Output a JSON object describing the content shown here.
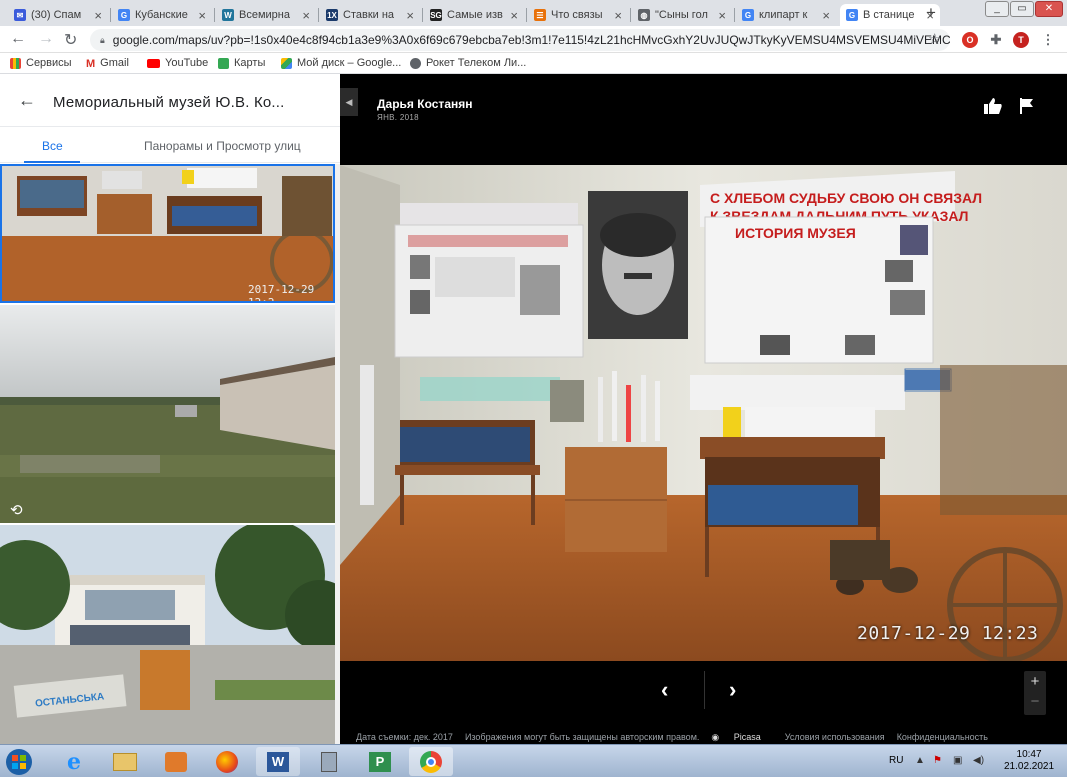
{
  "browser": {
    "tabs": [
      {
        "title": "(30) Спам",
        "icon": "mail-icon",
        "color": "#3b5bdb",
        "glyph": "✉"
      },
      {
        "title": "Кубанские",
        "icon": "google-icon",
        "color": "#4285f4",
        "glyph": "G"
      },
      {
        "title": "Всемирна",
        "icon": "wordpress-icon",
        "color": "#21759b",
        "glyph": "W"
      },
      {
        "title": "Ставки на",
        "icon": "1x-icon",
        "color": "#1b3a6b",
        "glyph": "1X"
      },
      {
        "title": "Самые изв",
        "icon": "sg-icon",
        "color": "#222222",
        "glyph": "SG"
      },
      {
        "title": "Что связы",
        "icon": "rss-icon",
        "color": "#e8710a",
        "glyph": "☰"
      },
      {
        "title": "\"Сыны гол",
        "icon": "globe-icon",
        "color": "#5f6368",
        "glyph": "◍"
      },
      {
        "title": "клипарт к",
        "icon": "google-icon",
        "color": "#4285f4",
        "glyph": "G"
      },
      {
        "title": "В станице",
        "icon": "google-icon",
        "color": "#4285f4",
        "glyph": "G"
      }
    ],
    "new_tab": "+",
    "url": "google.com/maps/uv?pb=!1s0x40e4c8f94cb1a3e9%3A0x6f69c679ebcba7eb!3m1!7e115!4zL21hcHMvcGxhY2UvJUQwJTkyKyVEMSU4MSVEMSU4MiVEMC"
  },
  "bookmarks": [
    {
      "label": "Сервисы",
      "icon": "apps-icon",
      "color": "#5f6368"
    },
    {
      "label": "Gmail",
      "icon": "gmail-icon",
      "color": "#d93025"
    },
    {
      "label": "YouTube",
      "icon": "youtube-icon",
      "color": "#ff0000"
    },
    {
      "label": "Карты",
      "icon": "maps-icon",
      "color": "#34a853"
    },
    {
      "label": "Мой диск – Google...",
      "icon": "drive-icon",
      "color": "#fbbc04"
    },
    {
      "label": "Рокет Телеком Ли...",
      "icon": "rocket-icon",
      "color": "#202124"
    }
  ],
  "panel": {
    "title": "Мемориальный музей Ю.В. Ко...",
    "tabs": [
      "Все",
      "Панорамы и Просмотр улиц"
    ],
    "thumb_timestamp": "2017-12-29 12:2"
  },
  "viewer": {
    "author": "Дарья Костанян",
    "date": "ЯНВ. 2018",
    "timestamp": "2017-12-29 12:23",
    "footer": [
      "Дата съемки: дек. 2017",
      "Изображения могут быть защищены авторским правом.",
      "Picasa",
      "Условия использования",
      "Конфиденциальность"
    ]
  },
  "photo_texts": {
    "banner_line1": "С ХЛЕБОМ СУДЬБУ СВОЮ ОН СВЯЗАЛ",
    "banner_line2": "К ЗВЕЗДАМ ДАЛЬНИМ ПУТЬ УКАЗАЛ",
    "history": "ИСТОРИЯ МУЗЕЯ",
    "sign2": "ОСТАНЬСЬКА"
  },
  "taskbar": {
    "lang": "RU",
    "time": "10:47",
    "date": "21.02.2021"
  },
  "colors": {
    "accent": "#1a73e8",
    "viewer_bg": "#000000"
  }
}
